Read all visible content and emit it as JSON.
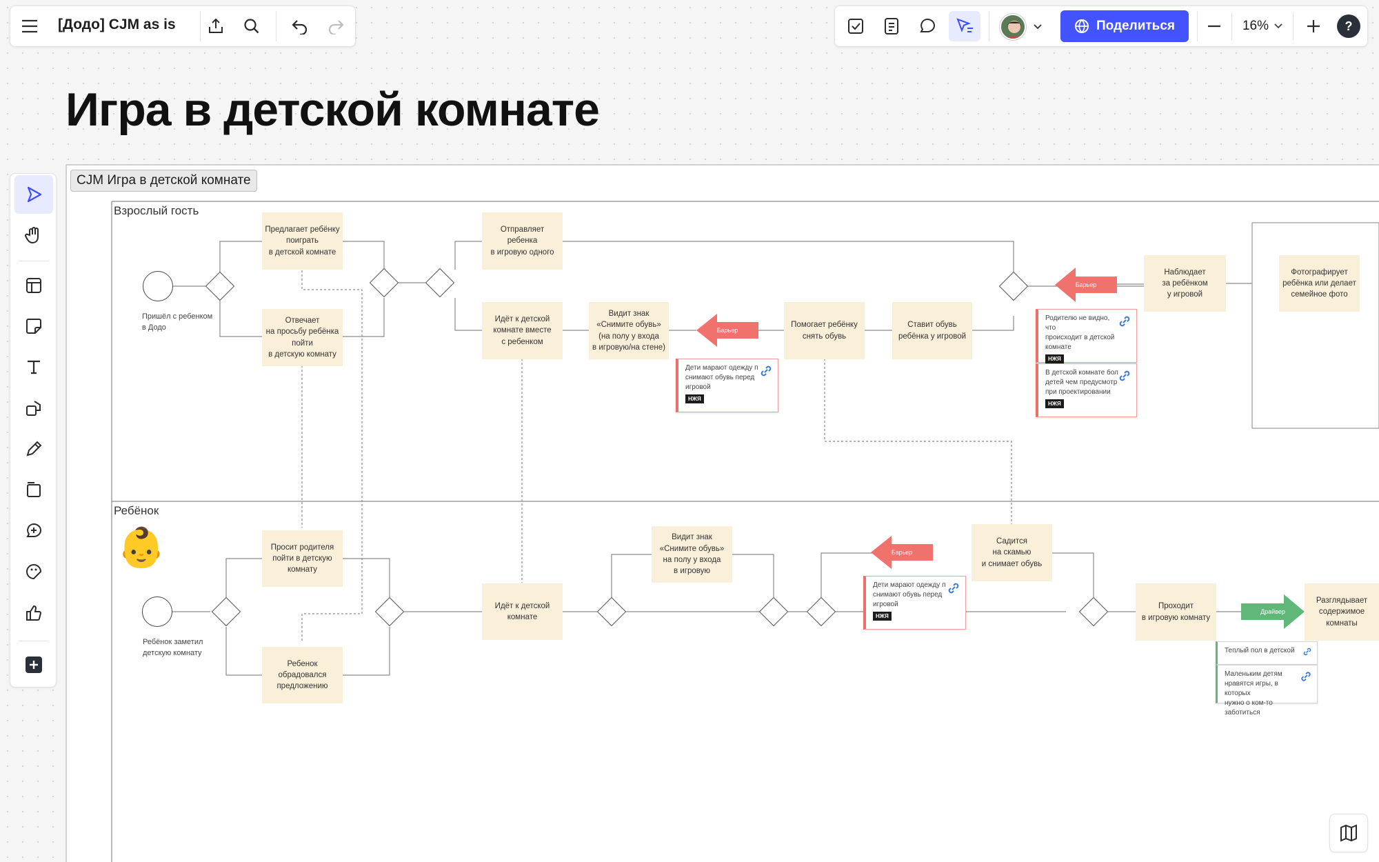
{
  "header": {
    "doc_title": "[Додо] CJM as is",
    "share_label": "Поделиться",
    "zoom": "16%",
    "help": "?"
  },
  "page_title": "Игра в детской комнате",
  "frame_label": "CJM Игра в детской комнате",
  "lanes": {
    "adult": "Взрослый гость",
    "child": "Ребёнок"
  },
  "adult": {
    "start_caption": "Пришёл с ребенком\nв Додо",
    "offers": "Предлагает ребёнку\nпоиграть\nв детской комнате",
    "answers": "Отвечает\nна просьбу ребёнка\nпойти\nв детскую комнату",
    "sends": "Отправляет ребенка\nв игровую одного",
    "goes_with": "Идёт к детской\nкомнате вместе\nс ребенком",
    "sees_sign": "Видит знак\n«Снимите обувь»\n(на полу у входа\nв игровую/на стене)",
    "helps": "Помогает ребёнку\nснять обувь",
    "puts_shoes": "Ставит обувь\nребёнка у игровой",
    "watches": "Наблюдает\nза ребёнком\nу игровой",
    "photo": "Фотографирует\nребёнка или делает\nсемейное фото"
  },
  "child": {
    "emoji": "👶",
    "start_caption": "Ребёнок заметил\nдетскую комнату",
    "asks": "Просит родителя\nпойти в детскую\nкомнату",
    "glad": "Ребенок\nобрадовался\nпредложению",
    "goes": "Идёт к детской\nкомнате",
    "sees_sign": "Видит знак\n«Снимите обувь»\nна полу у входа\nв игровую",
    "sits": "Садится\nна скамью\nи снимает обувь",
    "enters": "Проходит\nв игровую комнату",
    "looks": "Разглядывает\nсодержимое\nкомнаты"
  },
  "barrier_label": "Барьер",
  "driver_label": "Драйвер",
  "notes": {
    "dirty": "Дети марают одежду п\nснимают обувь перед\nигровой",
    "not_visible": "Родителю не видно, что\nпроисходит в детской\nкомнате",
    "more_kids": "В детской комнате бол\nдетей чем предусмотр\nпри проектировании",
    "dirty2": "Дети марают одежду п\nснимают обувь перед\nигровой",
    "warm_floor": "Теплый пол в детской",
    "kids_like": "Маленьким детям\nнравятся игры, в которых\nнужно о ком-то заботиться"
  },
  "tag_label": "НЖЯ",
  "colors": {
    "share": "#4353ff",
    "barrier": "#f0726c",
    "driver": "#5fb779",
    "sticky": "#faefd9"
  }
}
